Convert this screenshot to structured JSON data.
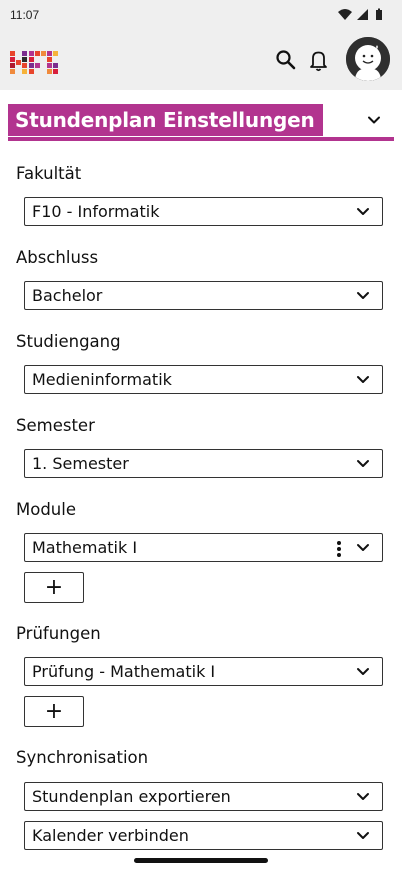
{
  "status_bar": {
    "time": "11:07"
  },
  "header": {
    "logo": "hfs-logo",
    "search_icon": "search-icon",
    "notifications_icon": "bell-icon",
    "avatar": "avatar-smiley"
  },
  "section": {
    "title": "Stundenplan Einstellungen",
    "accent": "#b2348f"
  },
  "form": {
    "fakultaet": {
      "label": "Fakultät",
      "value": "F10 - Informatik"
    },
    "abschluss": {
      "label": "Abschluss",
      "value": "Bachelor"
    },
    "studiengang": {
      "label": "Studiengang",
      "value": "Medieninformatik"
    },
    "semester": {
      "label": "Semester",
      "value": "1. Semester"
    },
    "module": {
      "label": "Module",
      "value": "Mathematik I",
      "add": "+"
    },
    "pruefungen": {
      "label": "Prüfungen",
      "value": "Prüfung - Mathematik I",
      "add": "+"
    },
    "synchronisation": {
      "label": "Synchronisation",
      "export": "Stundenplan exportieren",
      "calendar": "Kalender verbinden"
    }
  }
}
